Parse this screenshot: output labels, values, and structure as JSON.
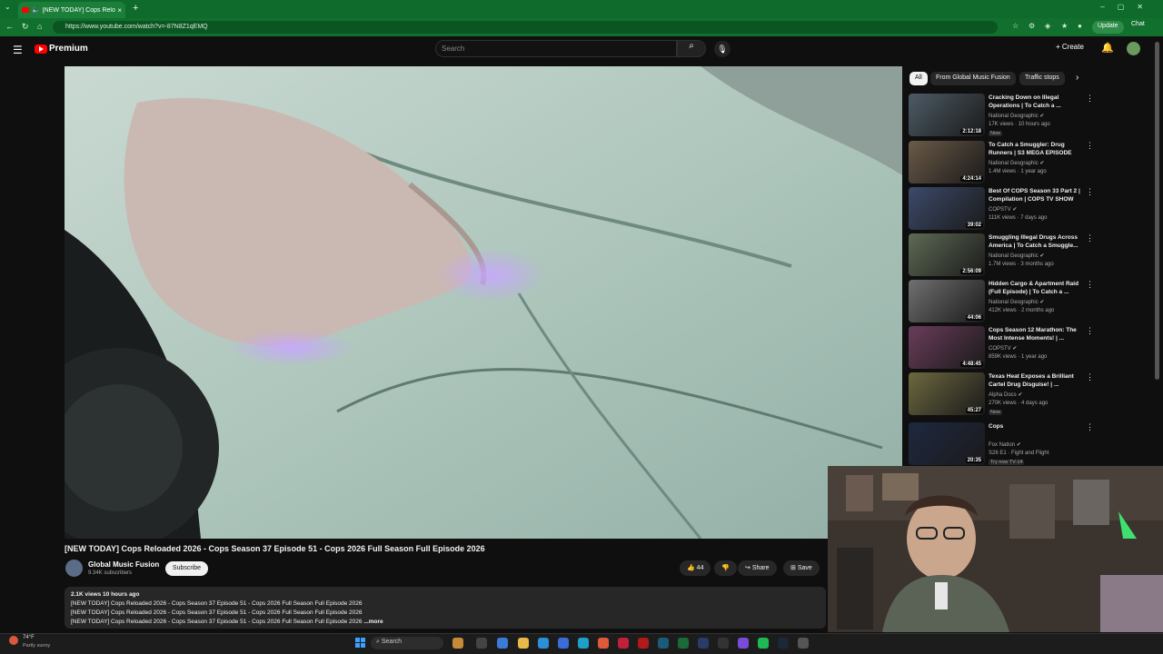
{
  "browser": {
    "tab_title": "[NEW TODAY] Cops Reloaded",
    "url": "https://www.youtube.com/watch?v=-87N8Z1qEMQ",
    "update_label": "Update",
    "chat_label": "Chat"
  },
  "masthead": {
    "logo_text": "Premium",
    "search_placeholder": "Search",
    "create_label": "Create"
  },
  "video": {
    "title": "[NEW TODAY] Cops Reloaded 2026 - Cops Season 37 Episode 51 - Cops 2026 Full Season Full Episode 2026",
    "channel": "Global Music Fusion",
    "subscribers": "9.34K subscribers",
    "subscribe_label": "Subscribe",
    "likes": "44",
    "share_label": "Share",
    "save_label": "Save",
    "description": {
      "meta": "2.1K views  10 hours ago",
      "lines": [
        "[NEW TODAY] Cops Reloaded 2026 - Cops Season 37 Episode 51 - Cops 2026 Full Season Full Episode 2026",
        "[NEW TODAY] Cops Reloaded 2026 - Cops Season 37 Episode 51 - Cops 2026 Full Season Full Episode 2026",
        "[NEW TODAY] Cops Reloaded 2026 - Cops Season 37 Episode 51 - Cops 2026 Full Season Full Episode 2026 "
      ],
      "more": "...more"
    }
  },
  "sidebar": {
    "chips": [
      "All",
      "From Global Music Fusion",
      "Traffic stops"
    ],
    "recommendations": [
      {
        "title": "Cracking Down on Illegal Operations | To Catch a ...",
        "channel": "National Geographic",
        "meta": "17K views · 10 hours ago",
        "badge": "New",
        "duration": "2:12:18",
        "thumb_color": "#4d5b66"
      },
      {
        "title": "To Catch a Smuggler: Drug Runners | S3 MEGA EPISODE",
        "channel": "National Geographic",
        "meta": "1.4M views · 1 year ago",
        "badge": "",
        "duration": "4:24:14",
        "thumb_color": "#6b5a48"
      },
      {
        "title": "Best Of COPS Season 33 Part 2 | Compilation | COPS TV SHOW",
        "channel": "COPSTV",
        "meta": "111K views · 7 days ago",
        "badge": "",
        "duration": "39:02",
        "thumb_color": "#3c4a6a"
      },
      {
        "title": "Smuggling Illegal Drugs Across America | To Catch a Smuggle...",
        "channel": "National Geographic",
        "meta": "1.7M views · 3 months ago",
        "badge": "",
        "duration": "2:56:09",
        "thumb_color": "#5e6a55"
      },
      {
        "title": "Hidden Cargo & Apartment Raid (Full Episode) | To Catch a ...",
        "channel": "National Geographic",
        "meta": "412K views · 2 months ago",
        "badge": "",
        "duration": "44:06",
        "thumb_color": "#707070"
      },
      {
        "title": "Cops Season 12 Marathon: The Most Intense Moments! | ...",
        "channel": "COPSTV",
        "meta": "859K views · 1 year ago",
        "badge": "",
        "duration": "4:48:45",
        "thumb_color": "#6a3c5a"
      },
      {
        "title": "Texas Heat Exposes a Brilliant Cartel Drug Disguise! | ...",
        "channel": "Alpha Docs",
        "meta": "270K views · 4 days ago",
        "badge": "New",
        "duration": "45:27",
        "thumb_color": "#6d6840"
      },
      {
        "title": "Cops",
        "channel": "Fox Nation",
        "meta": "S26 E1 · Fight and Flight",
        "badge": "Try now  TV-14",
        "duration": "20:35",
        "thumb_color": "#1e2840"
      }
    ]
  },
  "taskbar": {
    "weather_temp": "74°F",
    "weather_cond": "Partly sunny",
    "search_label": "Search"
  },
  "colors": {
    "browser_green": "#0f6b2b",
    "yt_red": "#ff0000",
    "background": "#0f0f0f"
  }
}
